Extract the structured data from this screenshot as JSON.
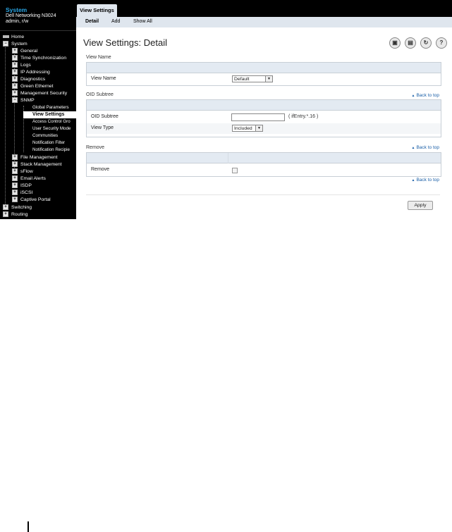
{
  "system": {
    "title": "System",
    "model": "Dell Networking N3024",
    "user": "admin, r/w"
  },
  "nav": {
    "home": "Home",
    "system": "System",
    "general": "General",
    "time_sync": "Time Synchronization",
    "logs": "Logs",
    "ip_addressing": "IP Addressing",
    "diagnostics": "Diagnostics",
    "green_ethernet": "Green Ethernet",
    "mgmt_security": "Management Security",
    "snmp": "SNMP",
    "global_parameters": "Global Parameters",
    "view_settings": "View Settings",
    "access_control": "Access Control Gro",
    "user_security": "User Security Mode",
    "communities": "Communities",
    "notification_filter": "Notification Filter",
    "notification_recipients": "Notification Recipie",
    "file_management": "File Management",
    "stack_management": "Stack Management",
    "sflow": "sFlow",
    "email_alerts": "Email Alerts",
    "isdp": "ISDP",
    "iscsi": "iSCSI",
    "captive_portal": "Captive Portal",
    "switching": "Switching",
    "routing": "Routing"
  },
  "tabs": {
    "main": "View Settings",
    "detail": "Detail",
    "add": "Add",
    "show_all": "Show All"
  },
  "page": {
    "title": "View Settings: Detail",
    "back_to_top": "Back to top",
    "apply": "Apply"
  },
  "view_name_section": {
    "title": "View Name",
    "label": "View Name",
    "value": "Default"
  },
  "oid_section": {
    "title": "OID Subtree",
    "subtree_label": "OID Subtree",
    "subtree_value": "",
    "subtree_hint": "( ifEntry.*.16 )",
    "view_type_label": "View Type",
    "view_type_value": "Included"
  },
  "remove_section": {
    "title": "Remove",
    "label": "Remove",
    "checked": false
  },
  "icons": [
    "save-icon",
    "print-icon",
    "refresh-icon",
    "help-icon"
  ],
  "colors": {
    "accent": "#2aa7e6",
    "link": "#1a5fa8",
    "panel_header": "#e3eaf2"
  }
}
